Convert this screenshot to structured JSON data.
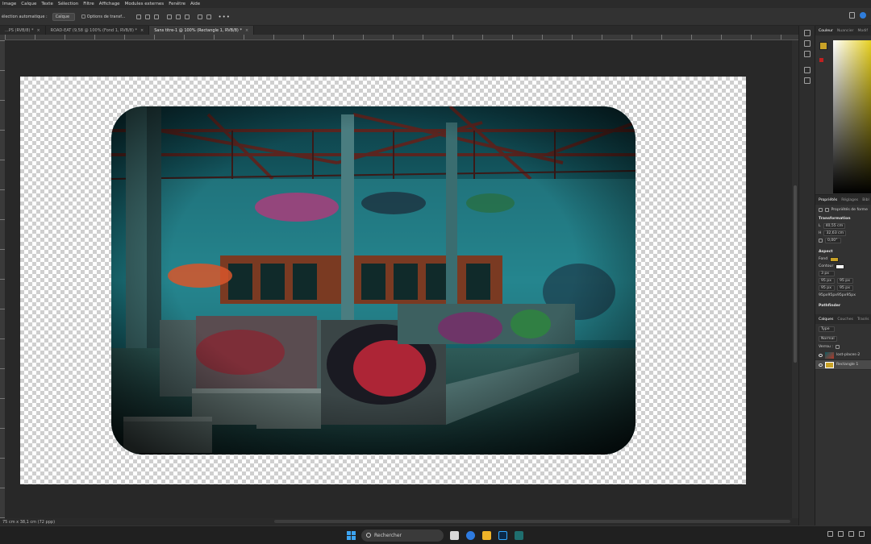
{
  "menubar": {
    "items": [
      "Image",
      "Calque",
      "Texte",
      "Sélection",
      "Filtre",
      "Affichage",
      "Modules externes",
      "Fenêtre",
      "Aide"
    ]
  },
  "options": {
    "auto_select_label": "élection automatique :",
    "auto_select_value": "Calque",
    "transform_label": "Options de transf..."
  },
  "tabs": [
    {
      "label": "...PS (RVB/8) *"
    },
    {
      "label": "ROAD-EAT (9,58 @ 100% (Fond 1, RVB/8) *"
    },
    {
      "label": "Sans titre-1 @ 100% (Rectangle 1, RVB/8) *"
    }
  ],
  "status": {
    "text": "75 cm x 38,1 cm (72 ppp)"
  },
  "panels": {
    "color_tabs": [
      "Couleur",
      "Nuancier",
      "Modif"
    ],
    "props_tabs": [
      "Propriétés",
      "Réglages",
      "Bibl"
    ],
    "shape_props_label": "Propriétés de forme",
    "transform_title": "Transformation",
    "w_label": "L",
    "w_value": "40,55 cm",
    "h_label": "H",
    "h_value": "32,63 cm",
    "angle_value": "0,00°",
    "aspect_title": "Aspect",
    "fill_label": "Fond",
    "stroke_label": "Contour",
    "stroke_size": "3 px",
    "radius_tl": "95 px",
    "radius_tr": "95 px",
    "radius_bl": "95 px",
    "radius_br": "95 px",
    "radius_summary": "95px95px95px95px",
    "pathfinder_title": "Pathfinder",
    "layers_tabs": [
      "Calques",
      "Couches",
      "Tracés"
    ],
    "filter_type": "Type",
    "blend_mode": "Normal",
    "lock_label": "Verrou :",
    "layers": [
      {
        "name": "lost-places-2"
      },
      {
        "name": "Rectangle 1"
      }
    ]
  },
  "taskbar": {
    "search_placeholder": "Rechercher"
  },
  "colors": {
    "fill": "#c9a227",
    "accent": "#2f7ddb"
  }
}
